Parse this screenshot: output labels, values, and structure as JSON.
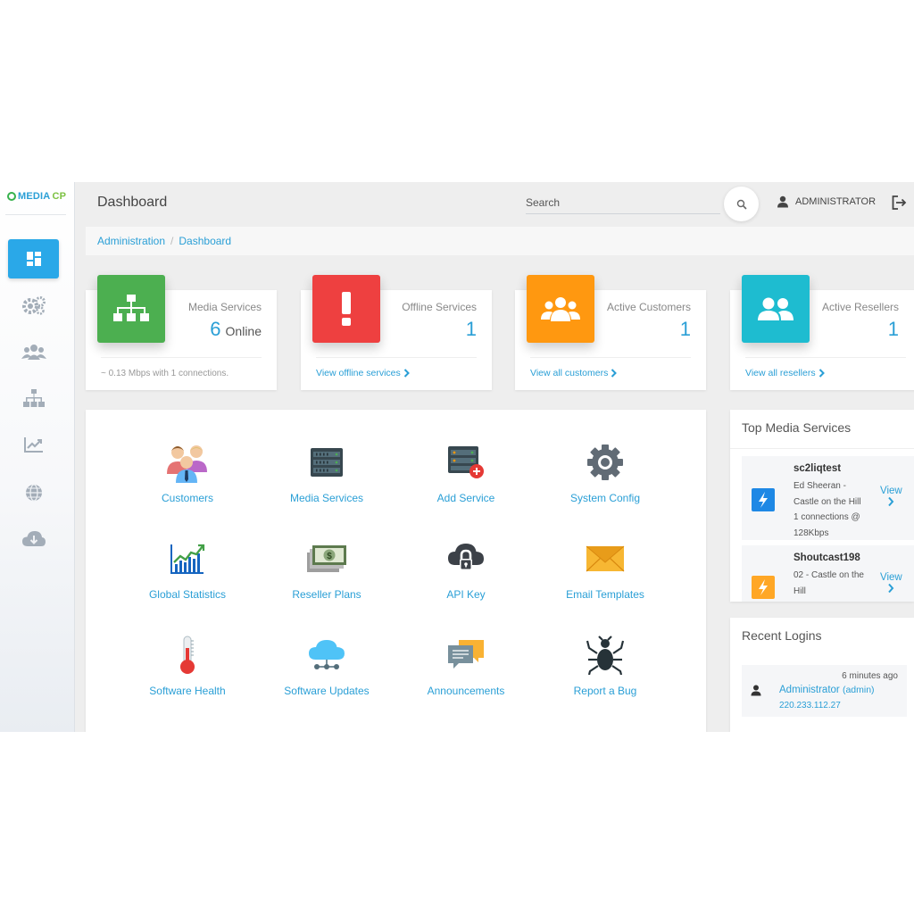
{
  "brand": {
    "name_main": "MEDIA",
    "name_accent": "CP"
  },
  "colors": {
    "accent": "#2aa8e8",
    "green": "#4caf50",
    "red": "#ee4040",
    "orange": "#ff9810",
    "teal": "#1ebcd0"
  },
  "sidebar": {
    "items": [
      {
        "icon": "dashboard-icon",
        "active": true
      },
      {
        "icon": "gears-icon",
        "active": false
      },
      {
        "icon": "users-icon",
        "active": false
      },
      {
        "icon": "sitemap-icon",
        "active": false
      },
      {
        "icon": "line-chart-icon",
        "active": false
      },
      {
        "icon": "globe-icon",
        "active": false
      },
      {
        "icon": "cloud-download-icon",
        "active": false
      }
    ]
  },
  "header": {
    "title": "Dashboard",
    "search_placeholder": "Search",
    "user_label": "ADMINISTRATOR"
  },
  "breadcrumb": {
    "items": [
      "Administration",
      "Dashboard"
    ]
  },
  "stats": [
    {
      "label": "Media Services",
      "value": "6",
      "suffix": "Online",
      "footer": "~ 0.13 Mbps with 1 connections."
    },
    {
      "label": "Offline Services",
      "value": "1",
      "link": "View offline services"
    },
    {
      "label": "Active Customers",
      "value": "1",
      "link": "View all customers"
    },
    {
      "label": "Active Resellers",
      "value": "1",
      "link": "View all resellers"
    }
  ],
  "tools": [
    {
      "label": "Customers",
      "icon": "customers-icon"
    },
    {
      "label": "Media Services",
      "icon": "server-icon"
    },
    {
      "label": "Add Service",
      "icon": "add-server-icon"
    },
    {
      "label": "System Config",
      "icon": "gear-icon"
    },
    {
      "label": "Global Statistics",
      "icon": "statistics-chart-icon"
    },
    {
      "label": "Reseller Plans",
      "icon": "money-icon"
    },
    {
      "label": "API Key",
      "icon": "cloud-lock-icon"
    },
    {
      "label": "Email Templates",
      "icon": "envelope-icon"
    },
    {
      "label": "Software Health",
      "icon": "thermometer-icon"
    },
    {
      "label": "Software Updates",
      "icon": "cloud-network-icon"
    },
    {
      "label": "Announcements",
      "icon": "chat-bubbles-icon"
    },
    {
      "label": "Report a Bug",
      "icon": "bug-icon"
    }
  ],
  "top_media": {
    "title": "Top Media Services",
    "view_label": "View",
    "items": [
      {
        "name": "sc2liqtest",
        "desc": "Ed Sheeran - Castle on the Hill 1 connections @ 128Kbps"
      },
      {
        "name": "Shoutcast198",
        "desc": "02 - Castle on the Hill"
      }
    ]
  },
  "recent_logins": {
    "title": "Recent Logins",
    "items": [
      {
        "time": "6 minutes ago",
        "user": "Administrator",
        "role": "(admin)",
        "ip": "220.233.112.27"
      }
    ]
  }
}
